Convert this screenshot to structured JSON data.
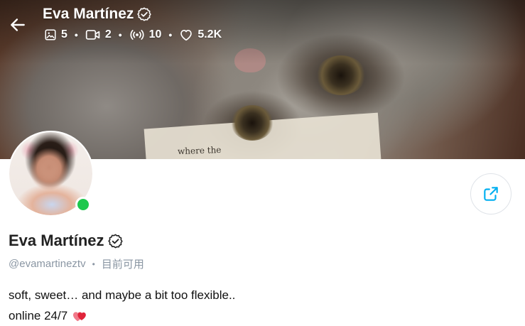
{
  "header": {
    "name": "Eva Martínez",
    "stats": {
      "photos": "5",
      "videos": "2",
      "streams": "10",
      "likes": "5.2K"
    }
  },
  "cover": {
    "paper_text": "where the"
  },
  "profile": {
    "name": "Eva Martínez",
    "handle": "@evamartineztv",
    "status": "目前可用",
    "bio_line1": "soft, sweet… and maybe a bit too flexible..",
    "bio_line2": "online 24/7"
  },
  "colors": {
    "accent": "#00aff0",
    "online": "#1ec84d",
    "muted_text": "#8a96a3",
    "heart": "#e0243a"
  },
  "icons": [
    "back-arrow-icon",
    "verified-badge-icon",
    "image-icon",
    "video-icon",
    "broadcast-icon",
    "heart-icon",
    "share-icon"
  ]
}
